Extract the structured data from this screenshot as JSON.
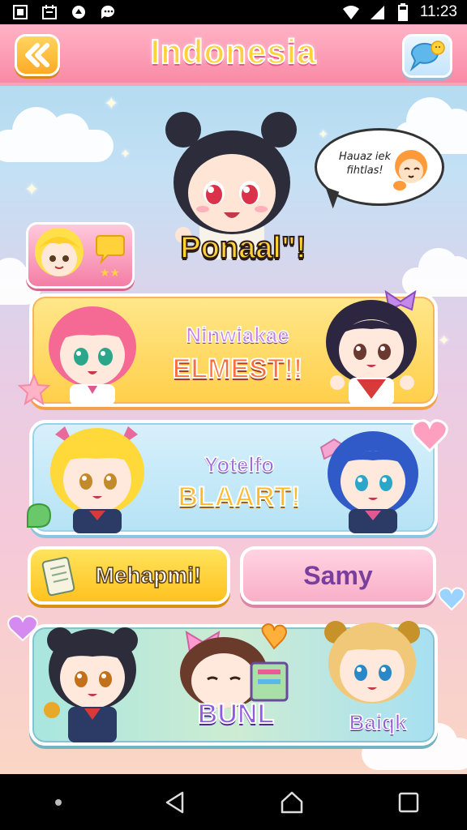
{
  "status_bar": {
    "time": "11:23",
    "left_icons": [
      "screenshot-icon",
      "calendar-icon",
      "app-icon",
      "chat-icon"
    ],
    "right_icons": [
      "wifi-icon",
      "signal-icon",
      "battery-icon"
    ]
  },
  "header": {
    "title": "Indonesia",
    "back_icon": "back-arrows-icon",
    "chat_icon": "chat-bubble-icon"
  },
  "hero": {
    "caption": "Ponaal\"!",
    "speech_text": "Hauaz iek fihtlas!"
  },
  "panels": [
    {
      "title_top": "Ninwiakae",
      "title_bottom": "ELMEST!!"
    },
    {
      "title_top": "Yotelfo",
      "title_bottom": "BLAART!"
    },
    {
      "title_top": "BUNL",
      "title_bottom": "Baiqk"
    }
  ],
  "buttons": {
    "left_label": "Mehapmi!",
    "right_label": "Samy"
  },
  "colors": {
    "header_bg": "#f98aa6",
    "title_fill": "#ffd23a",
    "panel_yellow": "#ffcf4a",
    "panel_blue": "#b5e3f5",
    "panel_green": "#a8e6df",
    "button_pink": "#f9aec8"
  },
  "nav": {
    "icons": [
      "dot-icon",
      "back-triangle-icon",
      "home-icon",
      "recent-apps-icon"
    ]
  }
}
